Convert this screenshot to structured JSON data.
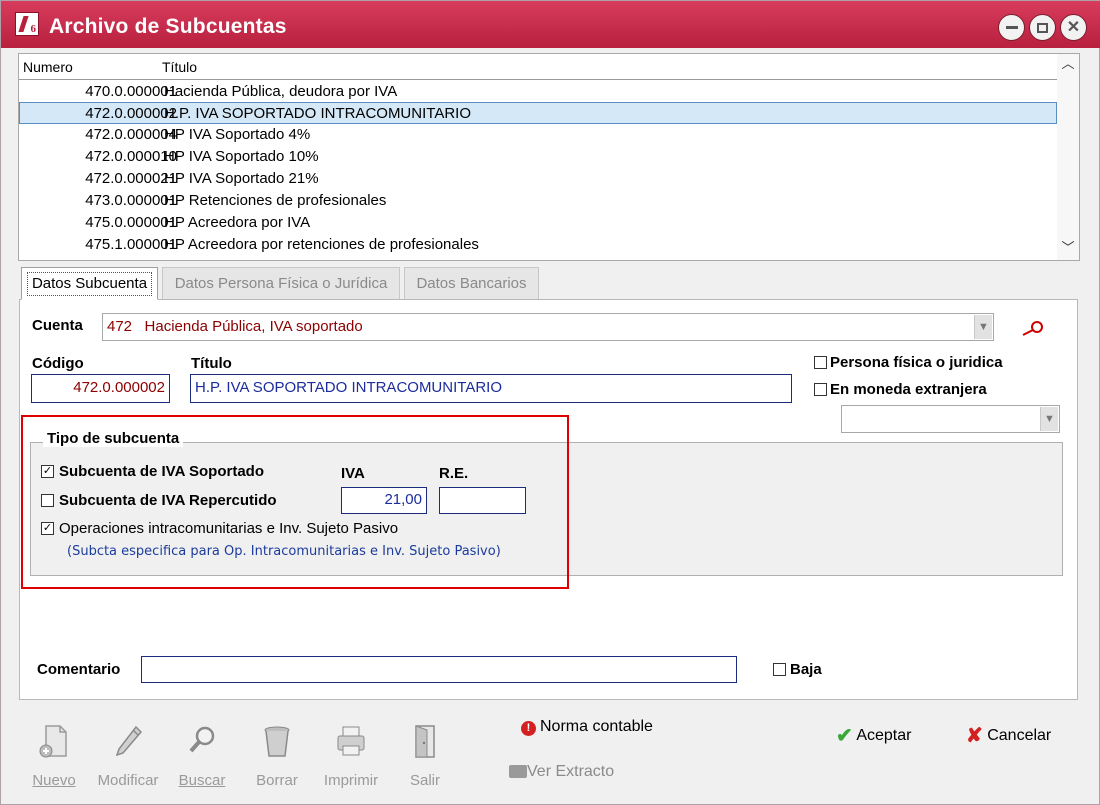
{
  "window": {
    "title": "Archivo de Subcuentas"
  },
  "list": {
    "headers": {
      "numero": "Numero",
      "titulo": "Título"
    },
    "rows": [
      {
        "numero": "470.0.000001",
        "titulo": "Hacienda Pública, deudora por IVA"
      },
      {
        "numero": "472.0.000002",
        "titulo": "H.P. IVA SOPORTADO INTRACOMUNITARIO"
      },
      {
        "numero": "472.0.000004",
        "titulo": "HP IVA Soportado 4%"
      },
      {
        "numero": "472.0.000010",
        "titulo": "HP IVA Soportado 10%"
      },
      {
        "numero": "472.0.000021",
        "titulo": "HP IVA Soportado 21%"
      },
      {
        "numero": "473.0.000001",
        "titulo": "HP Retenciones de profesionales"
      },
      {
        "numero": "475.0.000001",
        "titulo": "HP Acreedora por IVA"
      },
      {
        "numero": "475.1.000001",
        "titulo": "HP Acreedora por retenciones de profesionales"
      }
    ],
    "selected_index": 1
  },
  "tabs": [
    {
      "label": "Datos Subcuenta",
      "active": true
    },
    {
      "label": "Datos Persona Física o Jurídica",
      "active": false
    },
    {
      "label": "Datos Bancarios",
      "active": false
    }
  ],
  "form": {
    "cuenta_label": "Cuenta",
    "cuenta_value": "472   Hacienda Pública, IVA soportado",
    "codigo_label": "Código",
    "codigo_value": "472.0.000002",
    "titulo_label": "Título",
    "titulo_value": "H.P. IVA SOPORTADO INTRACOMUNITARIO",
    "persona_fisica_label": "Persona física o juridica",
    "persona_fisica_checked": false,
    "moneda_extranjera_label": "En moneda extranjera",
    "moneda_extranjera_checked": false,
    "moneda_value": "",
    "comentario_label": "Comentario",
    "comentario_value": "",
    "baja_label": "Baja",
    "baja_checked": false
  },
  "tipo_subcuenta": {
    "title": "Tipo de subcuenta",
    "iva_soportado_label": "Subcuenta de IVA Soportado",
    "iva_soportado_checked": true,
    "iva_repercutido_label": "Subcuenta de IVA Repercutido",
    "iva_repercutido_checked": false,
    "intracom_label": "Operaciones intracomunitarias e Inv. Sujeto Pasivo",
    "intracom_checked": true,
    "intracom_note": "(Subcta especifica para Op. Intracomunitarias e Inv. Sujeto Pasivo)",
    "iva_header": "IVA",
    "re_header": "R.E.",
    "iva_value": "21,00",
    "re_value": ""
  },
  "toolbar": {
    "nuevo": "Nuevo",
    "modificar": "Modificar",
    "buscar": "Buscar",
    "borrar": "Borrar",
    "imprimir": "Imprimir",
    "salir": "Salir"
  },
  "actions": {
    "norma_contable": "Norma contable",
    "ver_extracto": "Ver Extracto",
    "aceptar": "Aceptar",
    "cancelar": "Cancelar"
  },
  "colors": {
    "titlebar": "#c8304e",
    "selection": "#d4e8f8",
    "field_border": "#1c2c7c",
    "highlight_box": "#e00000"
  }
}
